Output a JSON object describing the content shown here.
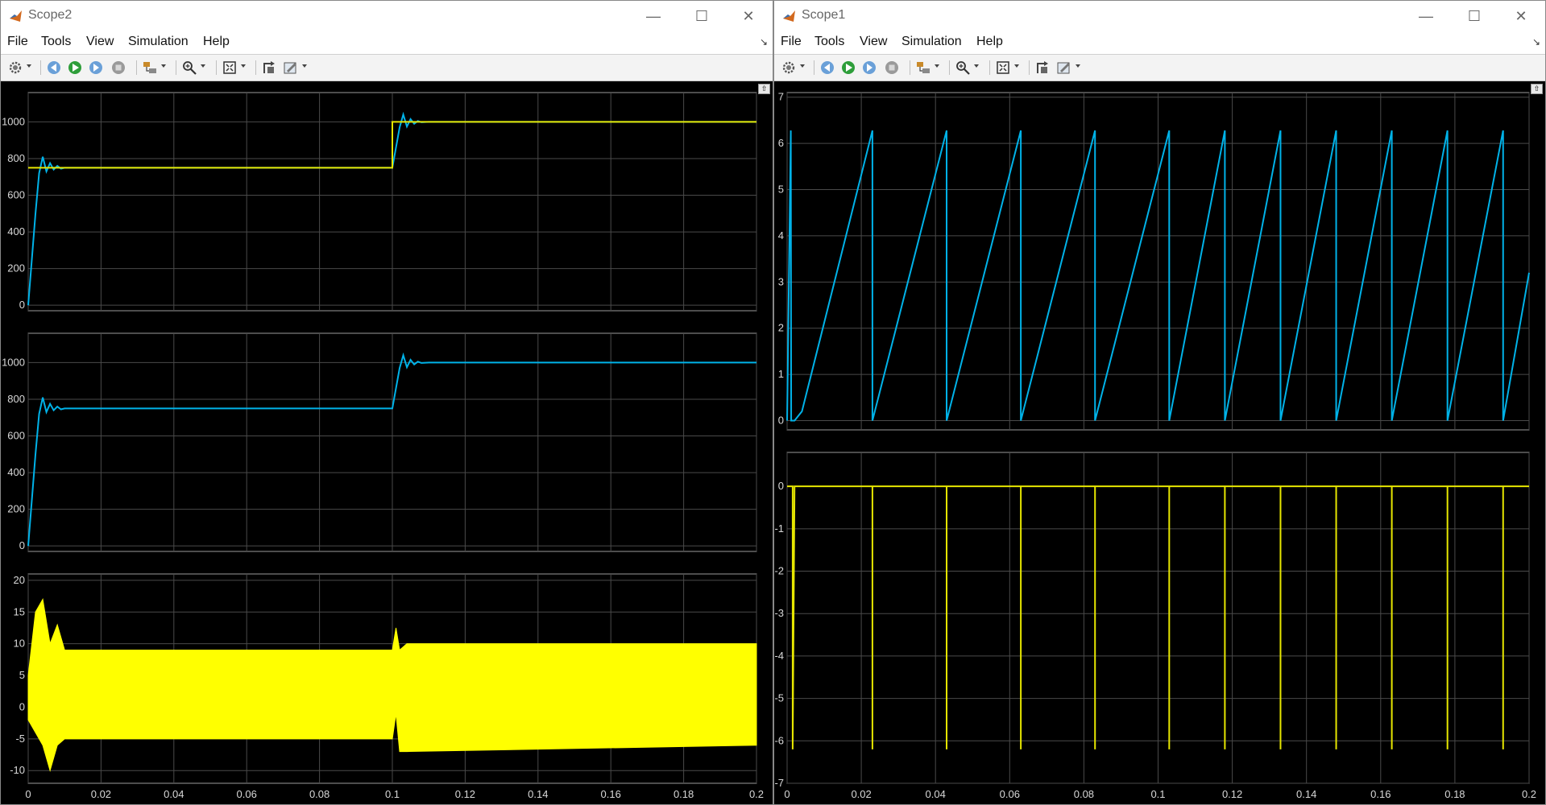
{
  "scope2": {
    "title": "Scope2",
    "menu": [
      "File",
      "Tools",
      "View",
      "Simulation",
      "Help"
    ],
    "toolbar_icons": [
      "settings-icon",
      "step-back-icon",
      "run-icon",
      "step-forward-icon",
      "stop-icon",
      "highlight-icon",
      "zoom-icon",
      "autoscale-icon",
      "restore-icon",
      "style-icon"
    ],
    "x_ticks": [
      "0",
      "0.02",
      "0.04",
      "0.06",
      "0.08",
      "0.1",
      "0.12",
      "0.14",
      "0.16",
      "0.18",
      "0.2"
    ]
  },
  "scope1": {
    "title": "Scope1",
    "menu": [
      "File",
      "Tools",
      "View",
      "Simulation",
      "Help"
    ],
    "toolbar_icons": [
      "settings-icon",
      "step-back-icon",
      "run-icon",
      "step-forward-icon",
      "stop-icon",
      "highlight-icon",
      "zoom-icon",
      "autoscale-icon",
      "restore-icon",
      "style-icon"
    ],
    "x_ticks": [
      "0",
      "0.02",
      "0.04",
      "0.06",
      "0.08",
      "0.1",
      "0.12",
      "0.14",
      "0.16",
      "0.18",
      "0.2"
    ]
  },
  "chart_data": [
    {
      "id": "scope2-axes1",
      "type": "line",
      "xlim": [
        0,
        0.2
      ],
      "ylim": [
        -30,
        1160
      ],
      "grid": true,
      "yticks": [
        0,
        200,
        400,
        600,
        800,
        1000
      ],
      "series": [
        {
          "color": "#00b2e8",
          "x": [
            0,
            0.002,
            0.003,
            0.004,
            0.005,
            0.006,
            0.007,
            0.008,
            0.009,
            0.01,
            0.1,
            0.102,
            0.103,
            0.104,
            0.105,
            0.106,
            0.107,
            0.108,
            0.11,
            0.2
          ],
          "y": [
            0,
            500,
            720,
            810,
            730,
            775,
            740,
            760,
            745,
            750,
            750,
            970,
            1040,
            975,
            1015,
            990,
            1005,
            998,
            1000,
            1000
          ]
        },
        {
          "color": "#e6e600",
          "x": [
            0,
            0.1,
            0.1,
            0.2
          ],
          "y": [
            750,
            750,
            1000,
            1000
          ]
        }
      ]
    },
    {
      "id": "scope2-axes2",
      "type": "line",
      "xlim": [
        0,
        0.2
      ],
      "ylim": [
        -30,
        1160
      ],
      "grid": true,
      "yticks": [
        0,
        200,
        400,
        600,
        800,
        1000
      ],
      "series": [
        {
          "color": "#00b2e8",
          "x": [
            0,
            0.002,
            0.003,
            0.004,
            0.005,
            0.006,
            0.007,
            0.008,
            0.009,
            0.01,
            0.1,
            0.102,
            0.103,
            0.104,
            0.105,
            0.106,
            0.107,
            0.108,
            0.11,
            0.2
          ],
          "y": [
            0,
            500,
            720,
            810,
            730,
            775,
            740,
            760,
            745,
            750,
            750,
            970,
            1040,
            975,
            1015,
            990,
            1005,
            998,
            1000,
            1000
          ]
        }
      ]
    },
    {
      "id": "scope2-axes3",
      "type": "area",
      "xlim": [
        0,
        0.2
      ],
      "ylim": [
        -12,
        21
      ],
      "grid": true,
      "yticks": [
        -10,
        -5,
        0,
        5,
        10,
        15,
        20
      ],
      "series": [
        {
          "color": "#ffff00",
          "upper_x": [
            0,
            0.002,
            0.004,
            0.006,
            0.008,
            0.01,
            0.1,
            0.101,
            0.102,
            0.104,
            0.2
          ],
          "upper_y": [
            5,
            15,
            17,
            10,
            13,
            9,
            9,
            12.5,
            9,
            10,
            10
          ],
          "lower_x": [
            0,
            0.002,
            0.004,
            0.006,
            0.008,
            0.01,
            0.1,
            0.101,
            0.102,
            0.104,
            0.2
          ],
          "lower_y": [
            -2,
            -4,
            -6,
            -10,
            -6,
            -5,
            -5,
            -1,
            -7,
            -7,
            -6
          ]
        }
      ]
    },
    {
      "id": "scope1-axes1",
      "type": "line",
      "xlim": [
        0,
        0.2
      ],
      "ylim": [
        -0.2,
        7.1
      ],
      "grid": true,
      "yticks": [
        0,
        1,
        2,
        3,
        4,
        5,
        6,
        7
      ],
      "series": [
        {
          "color": "#00b2e8",
          "x": [
            0,
            0.001,
            0.0011,
            0.002,
            0.004,
            0.023,
            0.023,
            0.043,
            0.043,
            0.063,
            0.063,
            0.083,
            0.083,
            0.103,
            0.103,
            0.118,
            0.118,
            0.133,
            0.133,
            0.148,
            0.148,
            0.163,
            0.163,
            0.178,
            0.178,
            0.193,
            0.193,
            0.2
          ],
          "y": [
            0,
            6.28,
            0,
            0,
            0.2,
            6.28,
            0,
            6.28,
            0,
            6.28,
            0,
            6.28,
            0,
            6.28,
            0,
            6.28,
            0,
            6.28,
            0,
            6.28,
            0,
            6.28,
            0,
            6.28,
            0,
            6.28,
            0,
            3.2
          ]
        }
      ]
    },
    {
      "id": "scope1-axes2",
      "type": "line",
      "xlim": [
        0,
        0.2
      ],
      "ylim": [
        -7,
        0.8
      ],
      "grid": true,
      "yticks": [
        -7,
        -6,
        -5,
        -4,
        -3,
        -2,
        -1,
        0
      ],
      "series": [
        {
          "color": "#e6e600",
          "x": [
            0,
            0.0015,
            0.0015,
            0.002,
            0.023,
            0.023,
            0.023,
            0.043,
            0.043,
            0.043,
            0.063,
            0.063,
            0.063,
            0.083,
            0.083,
            0.083,
            0.103,
            0.103,
            0.103,
            0.118,
            0.118,
            0.118,
            0.133,
            0.133,
            0.133,
            0.148,
            0.148,
            0.148,
            0.163,
            0.163,
            0.163,
            0.178,
            0.178,
            0.178,
            0.193,
            0.193,
            0.193,
            0.2
          ],
          "y": [
            0,
            0,
            -6.2,
            0,
            0,
            -6.2,
            0,
            0,
            -6.2,
            0,
            0,
            -6.2,
            0,
            0,
            -6.2,
            0,
            0,
            -6.2,
            0,
            0,
            -6.2,
            0,
            0,
            -6.2,
            0,
            0,
            -6.2,
            0,
            0,
            -6.2,
            0,
            0,
            -6.2,
            0,
            0,
            -6.2,
            0,
            0
          ]
        }
      ]
    }
  ]
}
